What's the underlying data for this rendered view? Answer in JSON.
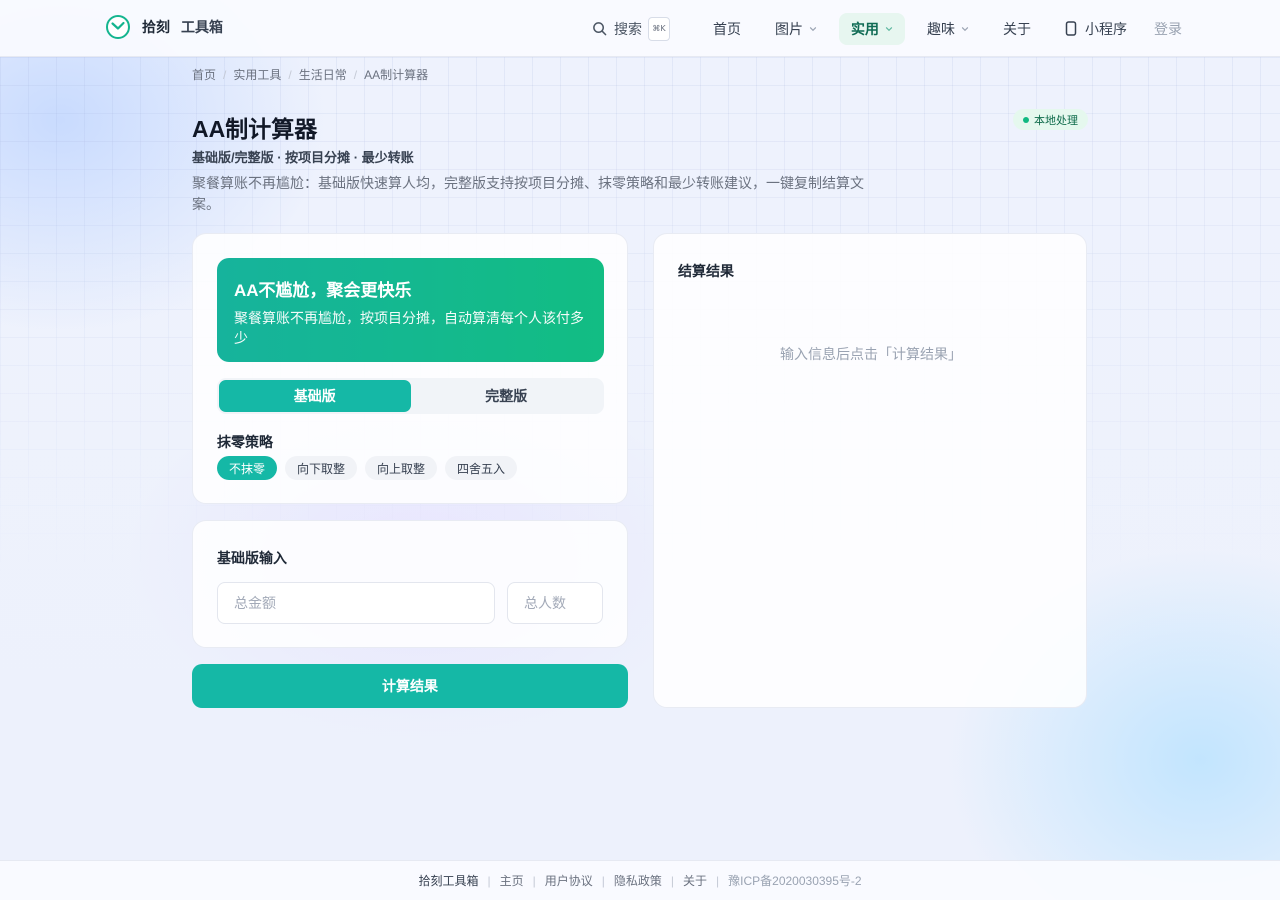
{
  "header": {
    "brand_name": "拾刻",
    "brand_sub": "工具箱",
    "search_label": "搜索",
    "search_shortcut": "⌘K",
    "nav": [
      {
        "label": "首页"
      },
      {
        "label": "图片"
      },
      {
        "label": "实用"
      },
      {
        "label": "趣味"
      },
      {
        "label": "关于"
      },
      {
        "label": "小程序"
      }
    ],
    "login_label": "登录",
    "accent": "#15b8a6"
  },
  "breadcrumb": [
    "首页",
    "实用工具",
    "生活日常",
    "AA制计算器"
  ],
  "page": {
    "title": "AA制计算器",
    "badge": "本地处理",
    "subtitle": "基础版/完整版 · 按项目分摊 · 最少转账",
    "description": "聚餐算账不再尴尬：基础版快速算人均，完整版支持按项目分摊、抹零策略和最少转账建议，一键复制结算文案。"
  },
  "hero": {
    "title": "AA不尴尬，聚会更快乐",
    "text": "聚餐算账不再尴尬，按项目分摊，自动算清每个人该付多少"
  },
  "mode_tabs": [
    {
      "label": "基础版",
      "active": true
    },
    {
      "label": "完整版",
      "active": false
    }
  ],
  "rounding": {
    "label": "抹零策略",
    "options": [
      "不抹零",
      "向下取整",
      "向上取整",
      "四舍五入"
    ],
    "selected": "不抹零"
  },
  "basic_input": {
    "label": "基础版输入",
    "amount_placeholder": "总金额",
    "people_placeholder": "总人数"
  },
  "calculate_button": "计算结果",
  "result": {
    "title": "结算结果",
    "empty_text": "输入信息后点击「计算结果」"
  },
  "footer": {
    "brand": "拾刻工具箱",
    "links": [
      "主页",
      "用户协议",
      "隐私政策",
      "关于"
    ],
    "icp": "豫ICP备2020030395号-2"
  }
}
